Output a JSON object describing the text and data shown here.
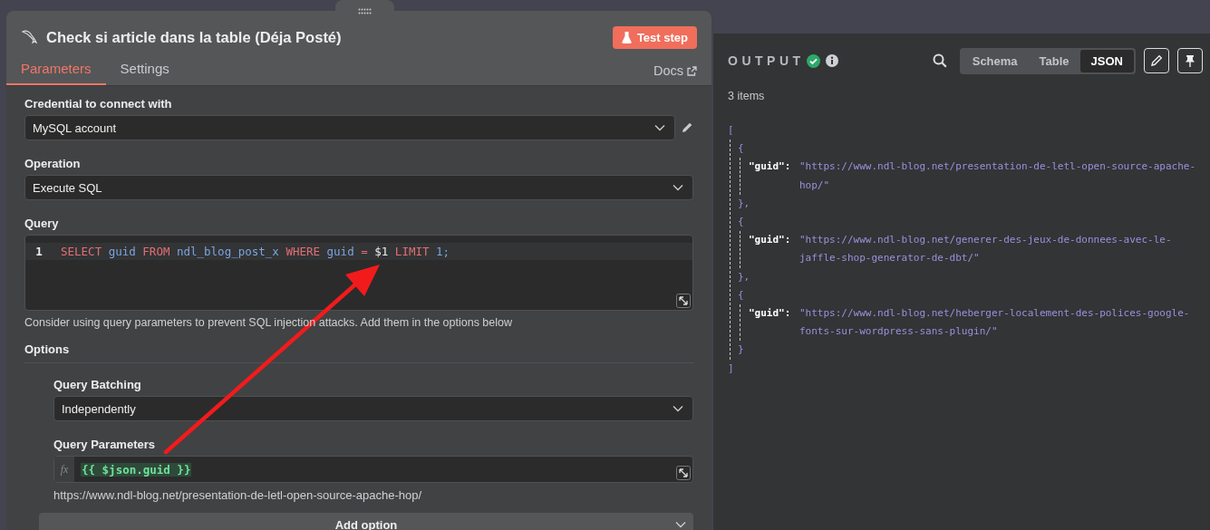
{
  "node": {
    "title": "Check si article dans la table (Déja Posté)",
    "test_button": "Test step",
    "docs_link": "Docs",
    "tabs": [
      {
        "label": "Parameters",
        "selected": true
      },
      {
        "label": "Settings",
        "selected": false
      }
    ],
    "fields": [
      {
        "kind": "select",
        "label": "Credential to connect with",
        "value": "MySQL account"
      },
      {
        "kind": "select",
        "label": "Operation",
        "value": "Execute SQL"
      },
      {
        "kind": "code",
        "label": "Query",
        "line_number": "1",
        "hint": "Consider using query parameters to prevent SQL injection attacks. Add them in the options below",
        "tokens": [
          {
            "kind": "keyword",
            "text": "SELECT"
          },
          {
            "kind": "name",
            "text": "guid"
          },
          {
            "kind": "keyword",
            "text": "FROM"
          },
          {
            "kind": "name",
            "text": "ndl_blog_post_x"
          },
          {
            "kind": "keyword",
            "text": "WHERE"
          },
          {
            "kind": "name",
            "text": "guid"
          },
          {
            "kind": "operator",
            "text": "="
          },
          {
            "kind": "param",
            "text": "$1"
          },
          {
            "kind": "keyword",
            "text": "LIMIT"
          },
          {
            "kind": "number",
            "text": "1;"
          }
        ]
      }
    ],
    "options": {
      "label": "Options",
      "add_button": "Add option",
      "items": [
        {
          "kind": "select",
          "label": "Query Batching",
          "value": "Independently"
        },
        {
          "kind": "expression",
          "label": "Query Parameters",
          "prefix": "fx",
          "value": "{{ $json.guid }}",
          "preview": "https://www.ndl-blog.net/presentation-de-letl-open-source-apache-hop/"
        }
      ]
    }
  },
  "output": {
    "title": "OUTPUT",
    "count": "3 items",
    "open": "[",
    "close": "]",
    "views": [
      {
        "label": "Schema",
        "selected": false
      },
      {
        "label": "Table",
        "selected": false
      },
      {
        "label": "JSON",
        "selected": true
      }
    ],
    "items": [
      {
        "open": "{",
        "key": "\"guid\":",
        "value": "\"https://www.ndl-blog.net/presentation-de-letl-open-source-apache-hop/\"",
        "close": "},"
      },
      {
        "open": "{",
        "key": "\"guid\":",
        "value": "\"https://www.ndl-blog.net/generer-des-jeux-de-donnees-avec-le-jaffle-shop-generator-de-dbt/\"",
        "close": "},"
      },
      {
        "open": "{",
        "key": "\"guid\":",
        "value": "\"https://www.ndl-blog.net/heberger-localement-des-polices-google-fonts-sur-wordpress-sans-plugin/\"",
        "close": "}"
      }
    ]
  }
}
